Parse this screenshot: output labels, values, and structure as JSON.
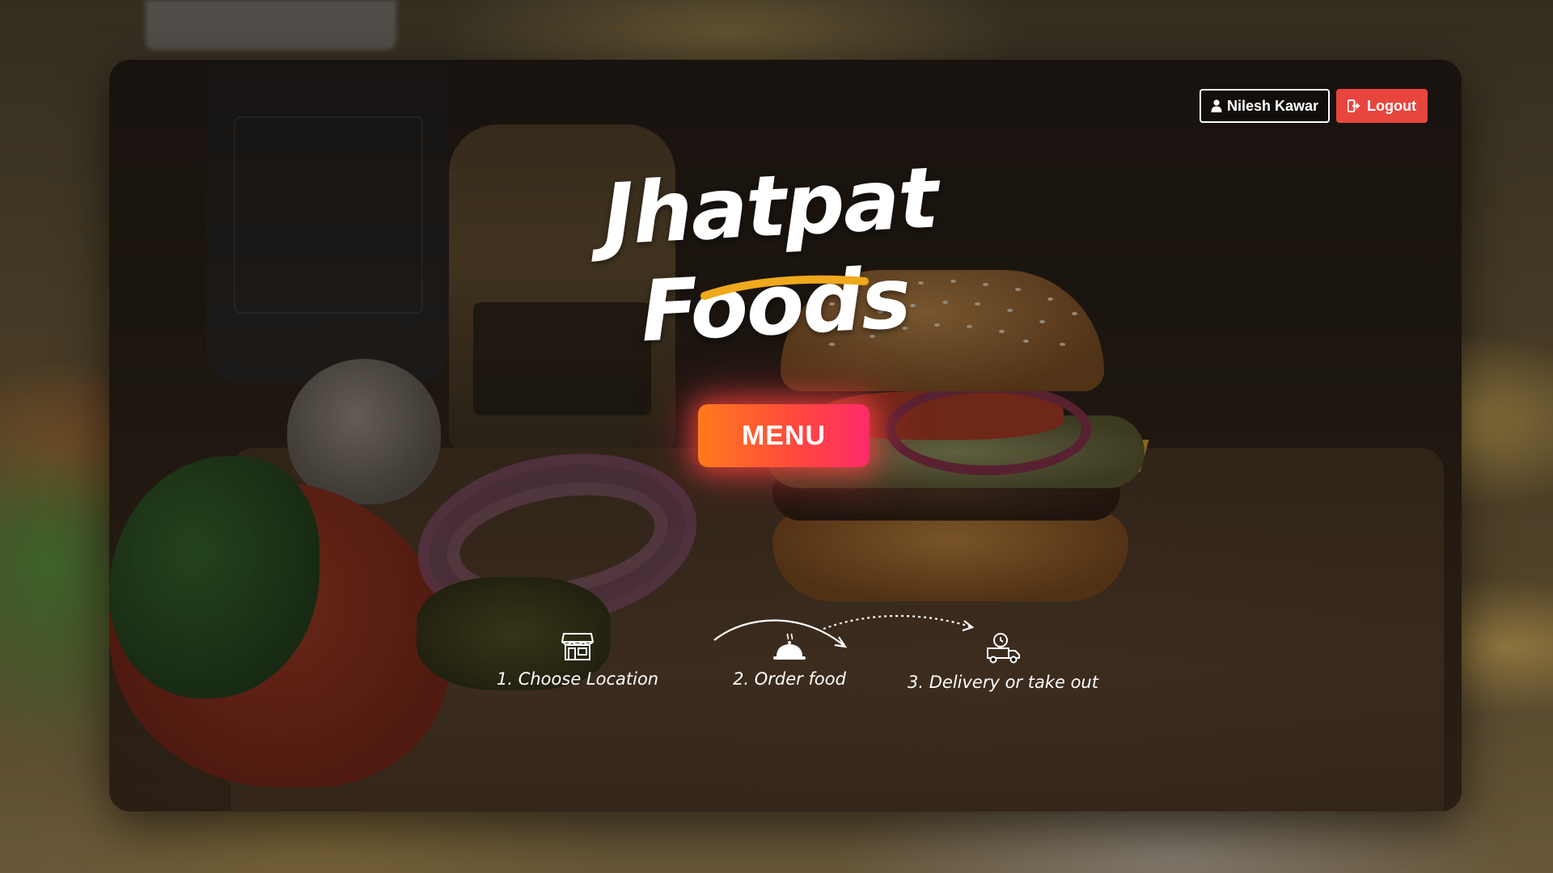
{
  "header": {
    "user_name": "Nilesh Kawar",
    "logout_label": "Logout"
  },
  "brand": {
    "title": "Jhatpat Foods",
    "underline_color": "#f0a81c"
  },
  "hero": {
    "menu_label": "MENU"
  },
  "steps": [
    {
      "label": "1. Choose Location",
      "icon": "store-icon"
    },
    {
      "label": "2. Order food",
      "icon": "cloche-icon"
    },
    {
      "label": "3. Delivery or take out",
      "icon": "delivery-truck-icon"
    }
  ],
  "colors": {
    "logout_bg": "#e8453f",
    "menu_gradient_start": "#ff7a1c",
    "menu_gradient_end": "#ff2a6a"
  }
}
